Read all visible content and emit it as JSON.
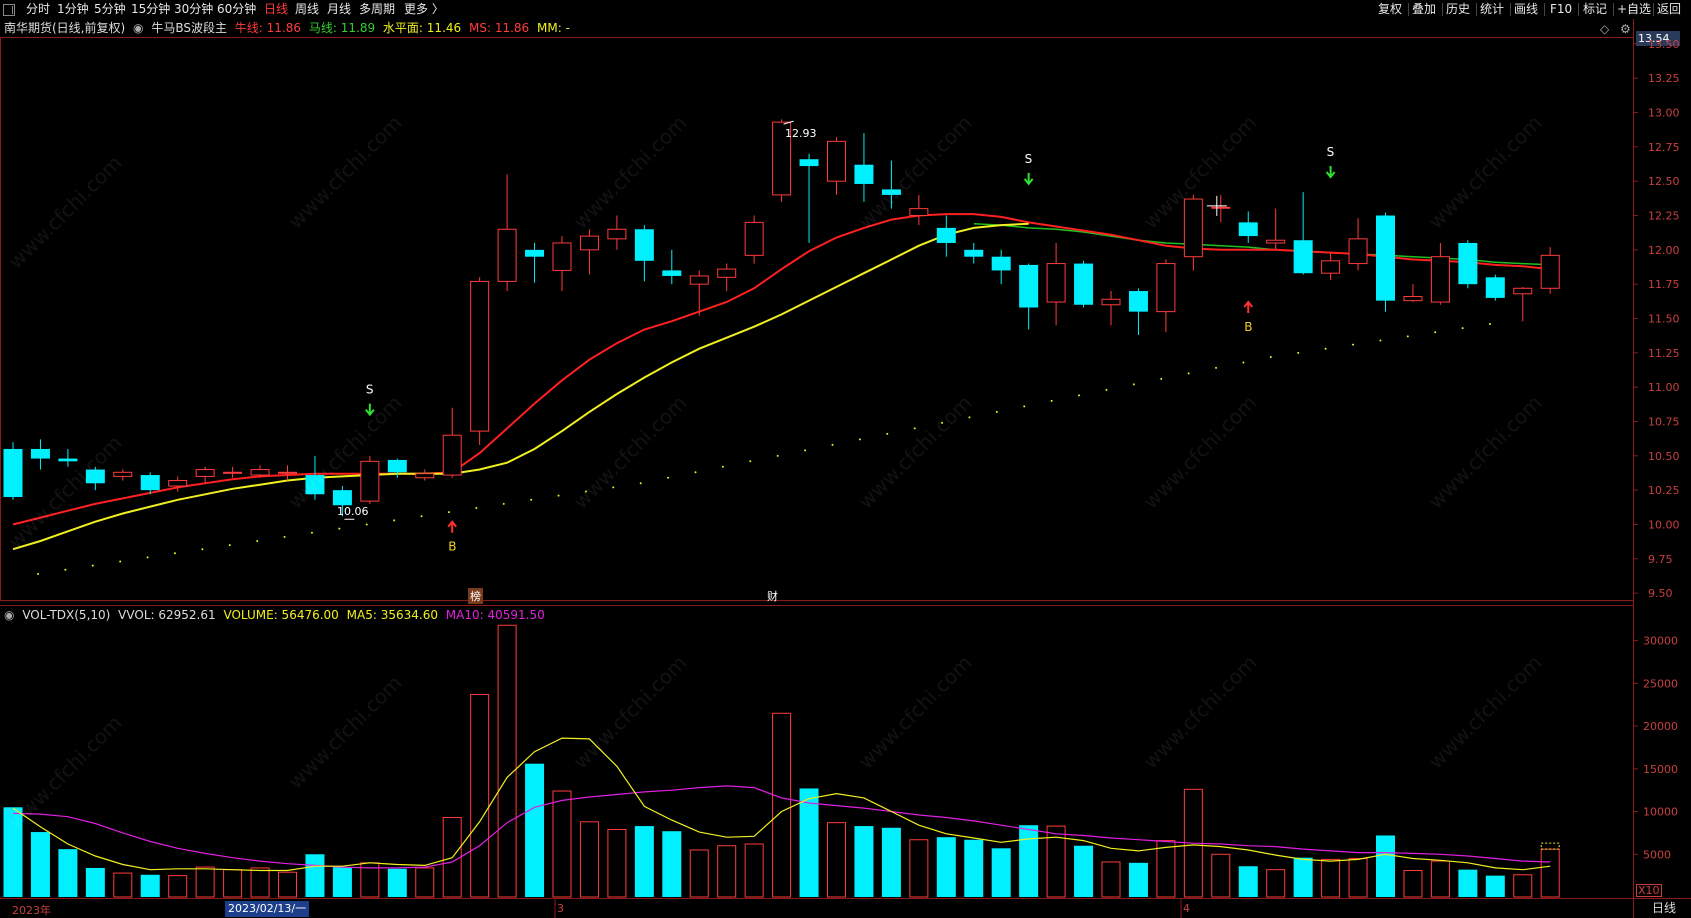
{
  "topbar": {
    "periods": [
      "分时",
      "1分钟",
      "5分钟",
      "15分钟",
      "30分钟",
      "60分钟",
      "日线",
      "周线",
      "月线",
      "多周期",
      "更多 〉"
    ],
    "active_period": "日线",
    "right_buttons": [
      "复权",
      "叠加",
      "历史",
      "统计",
      "画线",
      "F10",
      "标记",
      "+自选",
      "返回"
    ]
  },
  "info": {
    "stock": "南华期货(日线,前复权)",
    "indicator": "牛马BS波段主",
    "niu_label": "牛线:",
    "niu_value": "11.86",
    "ma_label": "马线:",
    "ma_value": "11.89",
    "level_label": "水平面:",
    "level_value": "11.46",
    "ms_label": "MS:",
    "ms_value": "11.86",
    "mm_label": "MM:",
    "mm_value": "-"
  },
  "volume_info": {
    "name": "VOL-TDX(5,10)",
    "vvol": "VVOL: 62952.61",
    "volume": "VOLUME: 56476.00",
    "ma5": "MA5: 35634.60",
    "ma10": "MA10: 40591.50"
  },
  "price_axis": [
    "13.50",
    "13.25",
    "13.00",
    "12.75",
    "12.50",
    "12.25",
    "12.00",
    "11.75",
    "11.50",
    "11.25",
    "11.00",
    "10.75",
    "10.50",
    "10.25",
    "10.00",
    "9.75",
    "9.50"
  ],
  "current_price": "13.54",
  "volume_axis": [
    "30000",
    "25000",
    "20000",
    "15000",
    "10000",
    "5000"
  ],
  "x10_label": "X10",
  "date_axis": {
    "year": "2023年",
    "selected": "2023/02/13/一",
    "mar": "3",
    "apr": "4",
    "period": "日线"
  },
  "annotations": {
    "high": "12.93",
    "low": "10.06",
    "s": "S",
    "b": "B",
    "bang": "榜",
    "cai": "财"
  },
  "watermark": "www.cfchi.com",
  "colors": {
    "up": "#ff3b3b",
    "down": "#00f0ff",
    "niu_line": "#ff2020",
    "ma_line": "#f0f020",
    "green_line": "#20c020",
    "ma5": "#f0f020",
    "ma10": "#e020e0"
  },
  "chart_data": {
    "type": "candlestick",
    "ylim": [
      9.45,
      13.55
    ],
    "candles": [
      [
        10.55,
        10.2,
        10.6,
        10.18
      ],
      [
        10.55,
        10.48,
        10.62,
        10.4
      ],
      [
        10.48,
        10.46,
        10.55,
        10.42
      ],
      [
        10.4,
        10.3,
        10.42,
        10.25
      ],
      [
        10.35,
        10.38,
        10.4,
        10.32
      ],
      [
        10.36,
        10.25,
        10.38,
        10.22
      ],
      [
        10.28,
        10.32,
        10.35,
        10.24
      ],
      [
        10.35,
        10.4,
        10.42,
        10.3
      ],
      [
        10.38,
        10.38,
        10.42,
        10.34
      ],
      [
        10.36,
        10.4,
        10.43,
        10.34
      ],
      [
        10.38,
        10.38,
        10.43,
        10.32
      ],
      [
        10.36,
        10.22,
        10.5,
        10.18
      ],
      [
        10.25,
        10.14,
        10.28,
        10.06
      ],
      [
        10.17,
        10.46,
        10.5,
        10.15
      ],
      [
        10.47,
        10.38,
        10.48,
        10.34
      ],
      [
        10.34,
        10.37,
        10.4,
        10.32
      ],
      [
        10.36,
        10.65,
        10.85,
        10.34
      ],
      [
        10.68,
        11.77,
        11.8,
        10.58
      ],
      [
        11.77,
        12.15,
        12.55,
        11.7
      ],
      [
        12.0,
        11.95,
        12.05,
        11.76
      ],
      [
        11.85,
        12.05,
        12.1,
        11.7
      ],
      [
        12.0,
        12.1,
        12.15,
        11.82
      ],
      [
        12.08,
        12.15,
        12.25,
        12.0
      ],
      [
        12.15,
        11.92,
        12.18,
        11.77
      ],
      [
        11.85,
        11.81,
        12.0,
        11.75
      ],
      [
        11.75,
        11.81,
        11.85,
        11.52
      ],
      [
        11.8,
        11.86,
        11.9,
        11.7
      ],
      [
        11.96,
        12.2,
        12.25,
        11.9
      ],
      [
        12.4,
        12.93,
        12.95,
        12.35
      ],
      [
        12.66,
        12.61,
        12.7,
        12.05
      ],
      [
        12.5,
        12.79,
        12.82,
        12.4
      ],
      [
        12.62,
        12.48,
        12.85,
        12.35
      ],
      [
        12.44,
        12.4,
        12.65,
        12.3
      ],
      [
        12.25,
        12.3,
        12.4,
        12.18
      ],
      [
        12.16,
        12.05,
        12.25,
        11.95
      ],
      [
        12.0,
        11.95,
        12.05,
        11.9
      ],
      [
        11.95,
        11.85,
        12.0,
        11.75
      ],
      [
        11.89,
        11.58,
        11.9,
        11.42
      ],
      [
        11.62,
        11.9,
        12.05,
        11.45
      ],
      [
        11.9,
        11.6,
        11.92,
        11.58
      ],
      [
        11.6,
        11.64,
        11.7,
        11.45
      ],
      [
        11.7,
        11.55,
        11.72,
        11.38
      ],
      [
        11.55,
        11.9,
        11.93,
        11.4
      ],
      [
        11.95,
        12.37,
        12.4,
        11.85
      ],
      [
        12.31,
        12.31,
        12.4,
        12.2
      ],
      [
        12.2,
        12.1,
        12.28,
        12.05
      ],
      [
        12.05,
        12.07,
        12.3,
        12.0
      ],
      [
        12.07,
        11.83,
        12.42,
        11.82
      ],
      [
        11.83,
        11.92,
        11.98,
        11.78
      ],
      [
        11.9,
        12.08,
        12.23,
        11.85
      ],
      [
        12.25,
        11.63,
        12.27,
        11.55
      ],
      [
        11.63,
        11.66,
        11.75,
        11.62
      ],
      [
        11.62,
        11.95,
        12.05,
        11.6
      ],
      [
        12.05,
        11.75,
        12.07,
        11.72
      ],
      [
        11.8,
        11.65,
        11.82,
        11.63
      ],
      [
        11.68,
        11.72,
        11.73,
        11.48
      ],
      [
        11.72,
        11.96,
        12.02,
        11.68
      ]
    ],
    "volumes": [
      10500,
      7600,
      5600,
      3400,
      2800,
      2600,
      2500,
      3500,
      3200,
      3400,
      2900,
      5000,
      3500,
      4000,
      3300,
      3400,
      9300,
      23700,
      31800,
      15600,
      12400,
      8800,
      7900,
      8300,
      7700,
      5500,
      6000,
      6200,
      21500,
      12700,
      8700,
      8300,
      8100,
      6700,
      7000,
      6700,
      5700,
      8400,
      8300,
      6000,
      4100,
      4000,
      6600,
      12600,
      5000,
      3600,
      3200,
      4600,
      4400,
      4500,
      7200,
      3100,
      4200,
      3200,
      2500,
      2600,
      5600
    ],
    "niu_line": [
      10.0,
      10.05,
      10.1,
      10.15,
      10.19,
      10.23,
      10.27,
      10.3,
      10.33,
      10.35,
      10.36,
      10.37,
      10.37,
      10.37,
      10.37,
      10.37,
      10.38,
      10.52,
      10.7,
      10.88,
      11.05,
      11.2,
      11.32,
      11.42,
      11.48,
      11.55,
      11.62,
      11.72,
      11.86,
      11.99,
      12.09,
      12.16,
      12.22,
      12.25,
      12.26,
      12.26,
      12.24,
      12.2,
      12.17,
      12.14,
      12.11,
      12.07,
      12.03,
      12.01,
      12.0,
      12.0,
      12.0,
      11.99,
      11.98,
      11.97,
      11.95,
      11.93,
      11.92,
      11.91,
      11.89,
      11.88,
      11.86
    ],
    "ma_line": [
      9.82,
      9.88,
      9.95,
      10.02,
      10.08,
      10.13,
      10.18,
      10.22,
      10.26,
      10.29,
      10.32,
      10.34,
      10.35,
      10.36,
      10.37,
      10.37,
      10.37,
      10.4,
      10.45,
      10.55,
      10.68,
      10.82,
      10.95,
      11.07,
      11.18,
      11.28,
      11.36,
      11.44,
      11.53,
      11.63,
      11.73,
      11.83,
      11.93,
      12.03,
      12.11,
      12.16,
      12.18,
      12.19
    ],
    "ma_line2": [
      12.19,
      12.18,
      12.16,
      12.15,
      12.13,
      12.1,
      12.07,
      12.05,
      12.04,
      12.03,
      12.02,
      12.0,
      11.99,
      11.98,
      11.97,
      11.96,
      11.95,
      11.94,
      11.93,
      11.91,
      11.9,
      11.89
    ],
    "level_dots": [
      9.64,
      9.67,
      9.7,
      9.73,
      9.76,
      9.79,
      9.82,
      9.85,
      9.88,
      9.91,
      9.94,
      9.97,
      10.0,
      10.03,
      10.06,
      10.09,
      10.12,
      10.15,
      10.18,
      10.21,
      10.24,
      10.27,
      10.3,
      10.34,
      10.38,
      10.42,
      10.46,
      10.5,
      10.54,
      10.58,
      10.62,
      10.66,
      10.7,
      10.74,
      10.78,
      10.82,
      10.86,
      10.9,
      10.94,
      10.98,
      11.02,
      11.06,
      11.1,
      11.14,
      11.18,
      11.22,
      11.25,
      11.28,
      11.31,
      11.34,
      11.37,
      11.4,
      11.43,
      11.46
    ],
    "vol_ma5": [
      10400,
      8200,
      6200,
      4800,
      3800,
      3200,
      3300,
      3300,
      3200,
      3100,
      3100,
      3600,
      3600,
      4000,
      3800,
      3700,
      4600,
      8800,
      14000,
      17000,
      18600,
      18500,
      15300,
      10600,
      9000,
      7600,
      7000,
      7100,
      10000,
      11500,
      12100,
      11600,
      10000,
      8400,
      7400,
      6900,
      6400,
      6800,
      7000,
      6600,
      5700,
      5400,
      5800,
      6100,
      5900,
      5500,
      4900,
      4400,
      4200,
      4400,
      5000,
      4500,
      4300,
      4000,
      3400,
      3200,
      3600
    ],
    "vol_ma10": [
      9800,
      9700,
      9400,
      8600,
      7500,
      6500,
      5700,
      5100,
      4600,
      4200,
      3900,
      3700,
      3500,
      3400,
      3400,
      3500,
      4100,
      6000,
      8700,
      10500,
      11300,
      11700,
      12000,
      12300,
      12500,
      12800,
      13000,
      12800,
      11600,
      11000,
      10700,
      10400,
      10000,
      9600,
      9300,
      8900,
      8400,
      7900,
      7400,
      7200,
      6900,
      6700,
      6500,
      6300,
      6200,
      6000,
      5900,
      5600,
      5400,
      5200,
      5200,
      5100,
      5000,
      4800,
      4500,
      4200,
      4100
    ]
  }
}
